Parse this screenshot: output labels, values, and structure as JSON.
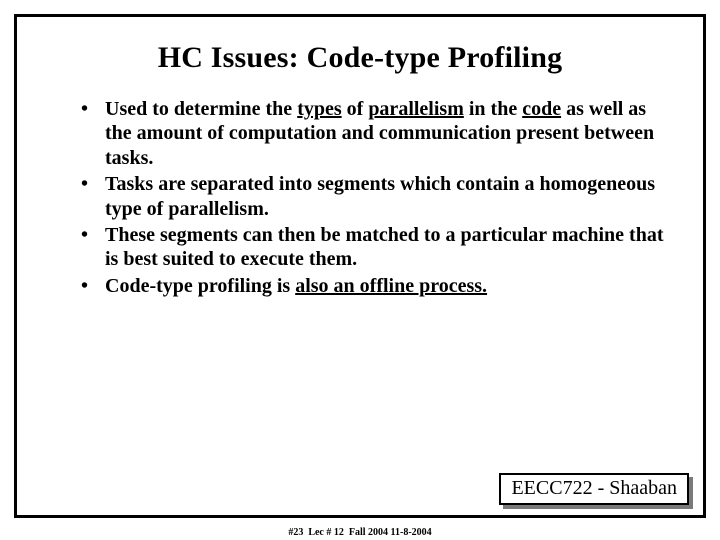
{
  "title": "HC Issues:  Code-type Profiling",
  "bullets": [
    {
      "pre": "Used to determine the ",
      "u1": "types",
      "mid1": " of ",
      "u2": "parallelism",
      "mid2": " in the ",
      "u3": "code",
      "post": " as well as the amount of computation and communication present between tasks."
    },
    {
      "text": "Tasks are separated into segments which contain a homogeneous type of parallelism."
    },
    {
      "text": "These segments can then be matched to a particular machine that is best suited to execute them."
    },
    {
      "pre": "Code-type profiling is ",
      "u1": "also an offline process.",
      "post": ""
    }
  ],
  "course_label": "EECC722 - Shaaban",
  "footer": {
    "slide_no": "#23",
    "lecture": "Lec # 12",
    "term": "Fall 2004",
    "date": "11-8-2004"
  }
}
